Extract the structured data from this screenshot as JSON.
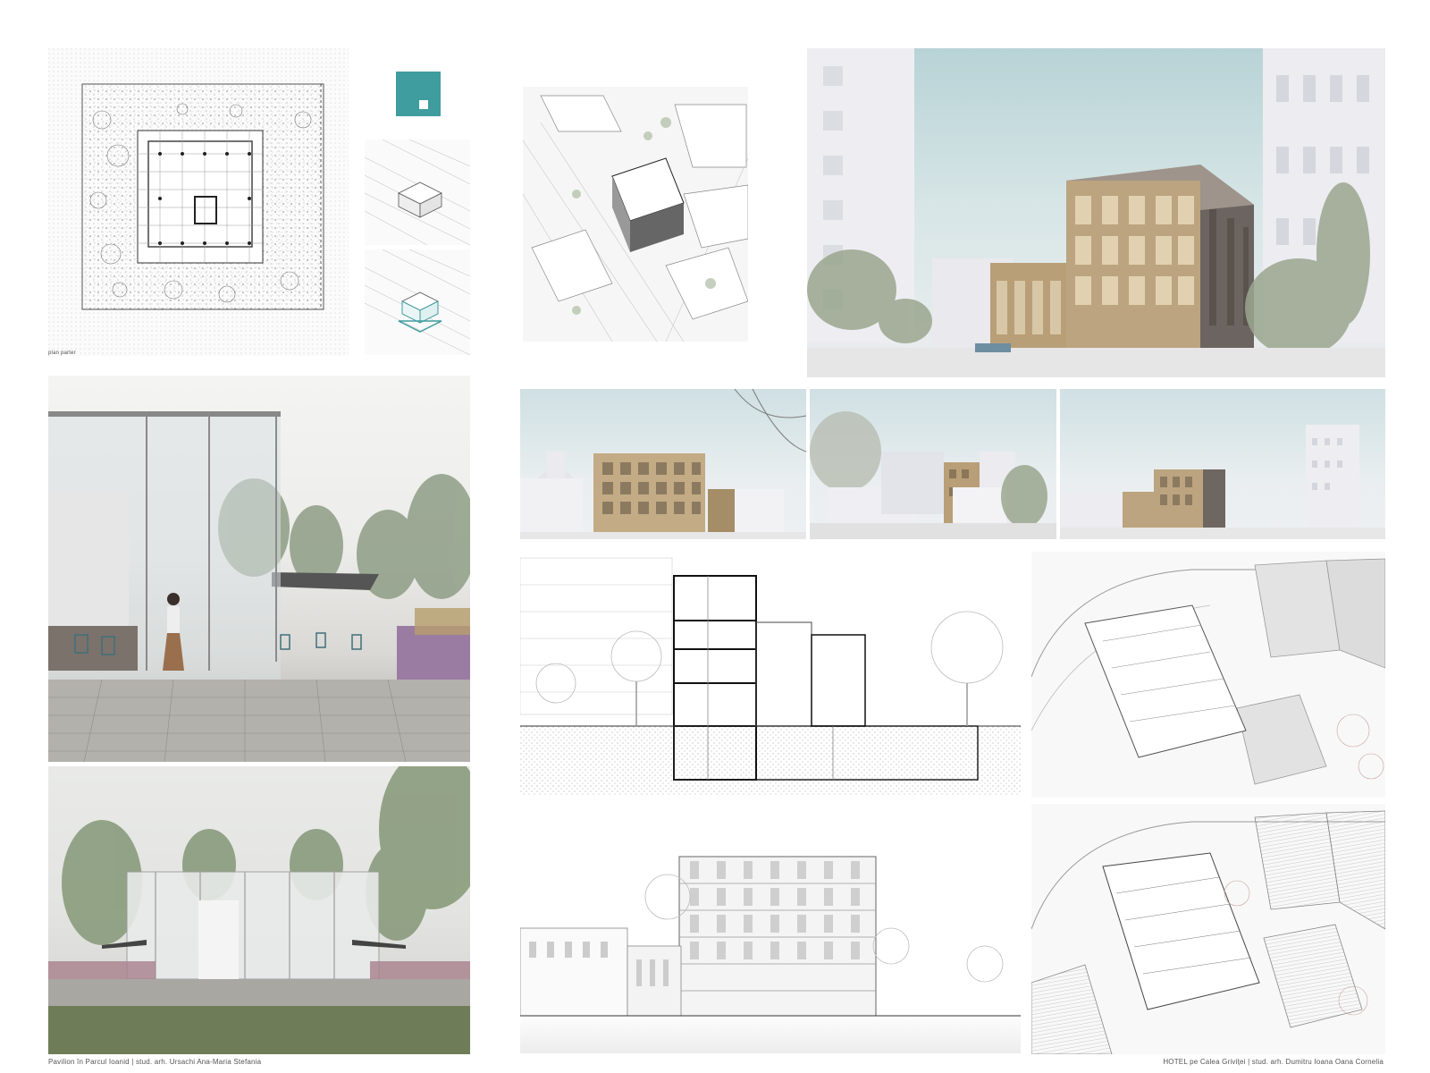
{
  "left_project": {
    "plan_label": "plan parter",
    "caption": "Pavilion în Parcul Ioanid | stud. arh. Ursachi Ana-Maria Stefania",
    "accent_color": "#3f9c9f"
  },
  "right_project": {
    "caption": "HOTEL pe Calea Griviței | stud. arh. Dumitru Ioana Oana Cornelia"
  },
  "colors": {
    "teal_logo": "#3f9c9f",
    "facade_wood": "#b99f78",
    "sky": "#d9e7e9",
    "paving": "#9a9895",
    "foliage": "#7f9470"
  }
}
